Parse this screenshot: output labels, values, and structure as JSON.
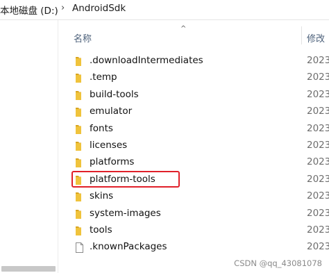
{
  "breadcrumb": {
    "drive": "本地磁盘 (D:)",
    "separator": "›",
    "folder": "AndroidSdk"
  },
  "columns": {
    "name": "名称",
    "date": "修改"
  },
  "files": [
    {
      "name": ".downloadIntermediates",
      "date": "2023",
      "type": "folder"
    },
    {
      "name": ".temp",
      "date": "2023",
      "type": "folder"
    },
    {
      "name": "build-tools",
      "date": "2023",
      "type": "folder"
    },
    {
      "name": "emulator",
      "date": "2023",
      "type": "folder"
    },
    {
      "name": "fonts",
      "date": "2023",
      "type": "folder"
    },
    {
      "name": "licenses",
      "date": "2023",
      "type": "folder"
    },
    {
      "name": "platforms",
      "date": "2023",
      "type": "folder"
    },
    {
      "name": "platform-tools",
      "date": "2023",
      "type": "folder",
      "highlighted": true
    },
    {
      "name": "skins",
      "date": "2023",
      "type": "folder"
    },
    {
      "name": "system-images",
      "date": "2023",
      "type": "folder"
    },
    {
      "name": "tools",
      "date": "2023",
      "type": "folder"
    },
    {
      "name": ".knownPackages",
      "date": "2023",
      "type": "file"
    }
  ],
  "watermark": "CSDN @qq_43081078",
  "colors": {
    "folder": "#f0c33c",
    "highlight": "#e0202a",
    "header_text": "#4c607a"
  },
  "icons": {
    "folder": "folder-icon",
    "file": "file-icon",
    "sort": "sort-up-icon"
  }
}
